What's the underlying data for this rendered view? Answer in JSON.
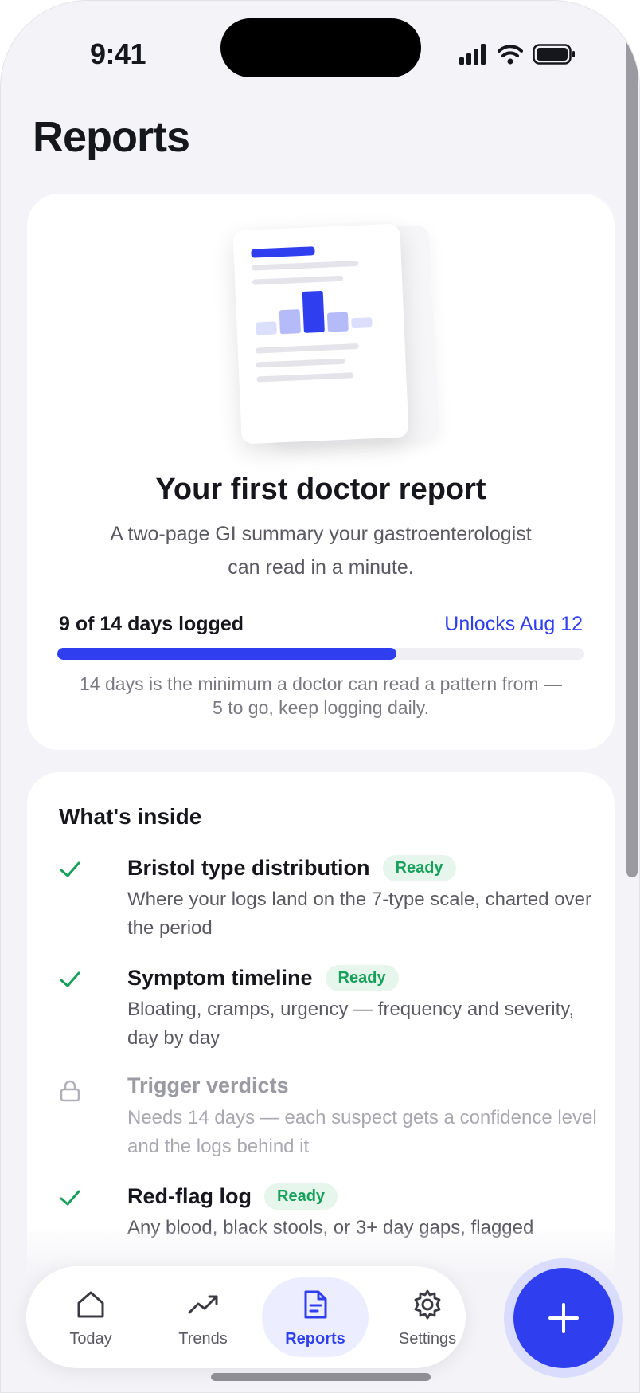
{
  "status_bar": {
    "time": "9:41"
  },
  "page": {
    "title": "Reports"
  },
  "report_card": {
    "title": "Your first doctor report",
    "description": "A two-page GI summary your gastroenterologist can read in a minute.",
    "progress_label": "9 of 14 days logged",
    "unlock_label": "Unlocks Aug 12",
    "progress_days_logged": 9,
    "progress_days_total": 14,
    "note": "14 days is the minimum a doctor can read a pattern from — 5 to go, keep logging daily."
  },
  "inside": {
    "title": "What's inside",
    "items": [
      {
        "icon": "check-icon",
        "name": "Bristol type distribution",
        "badge": "Ready",
        "desc": "Where your logs land on the 7-type scale, charted over the period"
      },
      {
        "icon": "check-icon",
        "name": "Symptom timeline",
        "badge": "Ready",
        "desc": "Bloating, cramps, urgency — frequency and severity, day by day"
      },
      {
        "icon": "lock-icon",
        "name": "Trigger verdicts",
        "badge": "",
        "desc": "Needs 14 days — each suspect gets a confidence level and the logs behind it"
      },
      {
        "icon": "check-icon",
        "name": "Red-flag log",
        "badge": "Ready",
        "desc": "Any blood, black stools, or 3+ day gaps, flagged"
      }
    ]
  },
  "nav": {
    "tabs": [
      {
        "label": "Today",
        "icon": "home-icon"
      },
      {
        "label": "Trends",
        "icon": "trend-icon"
      },
      {
        "label": "Reports",
        "icon": "document-icon"
      },
      {
        "label": "Settings",
        "icon": "gear-icon"
      }
    ],
    "active": "Reports"
  },
  "colors": {
    "accent": "#2f3ff0",
    "ready": "#16a05a",
    "background": "#f4f4f8"
  }
}
